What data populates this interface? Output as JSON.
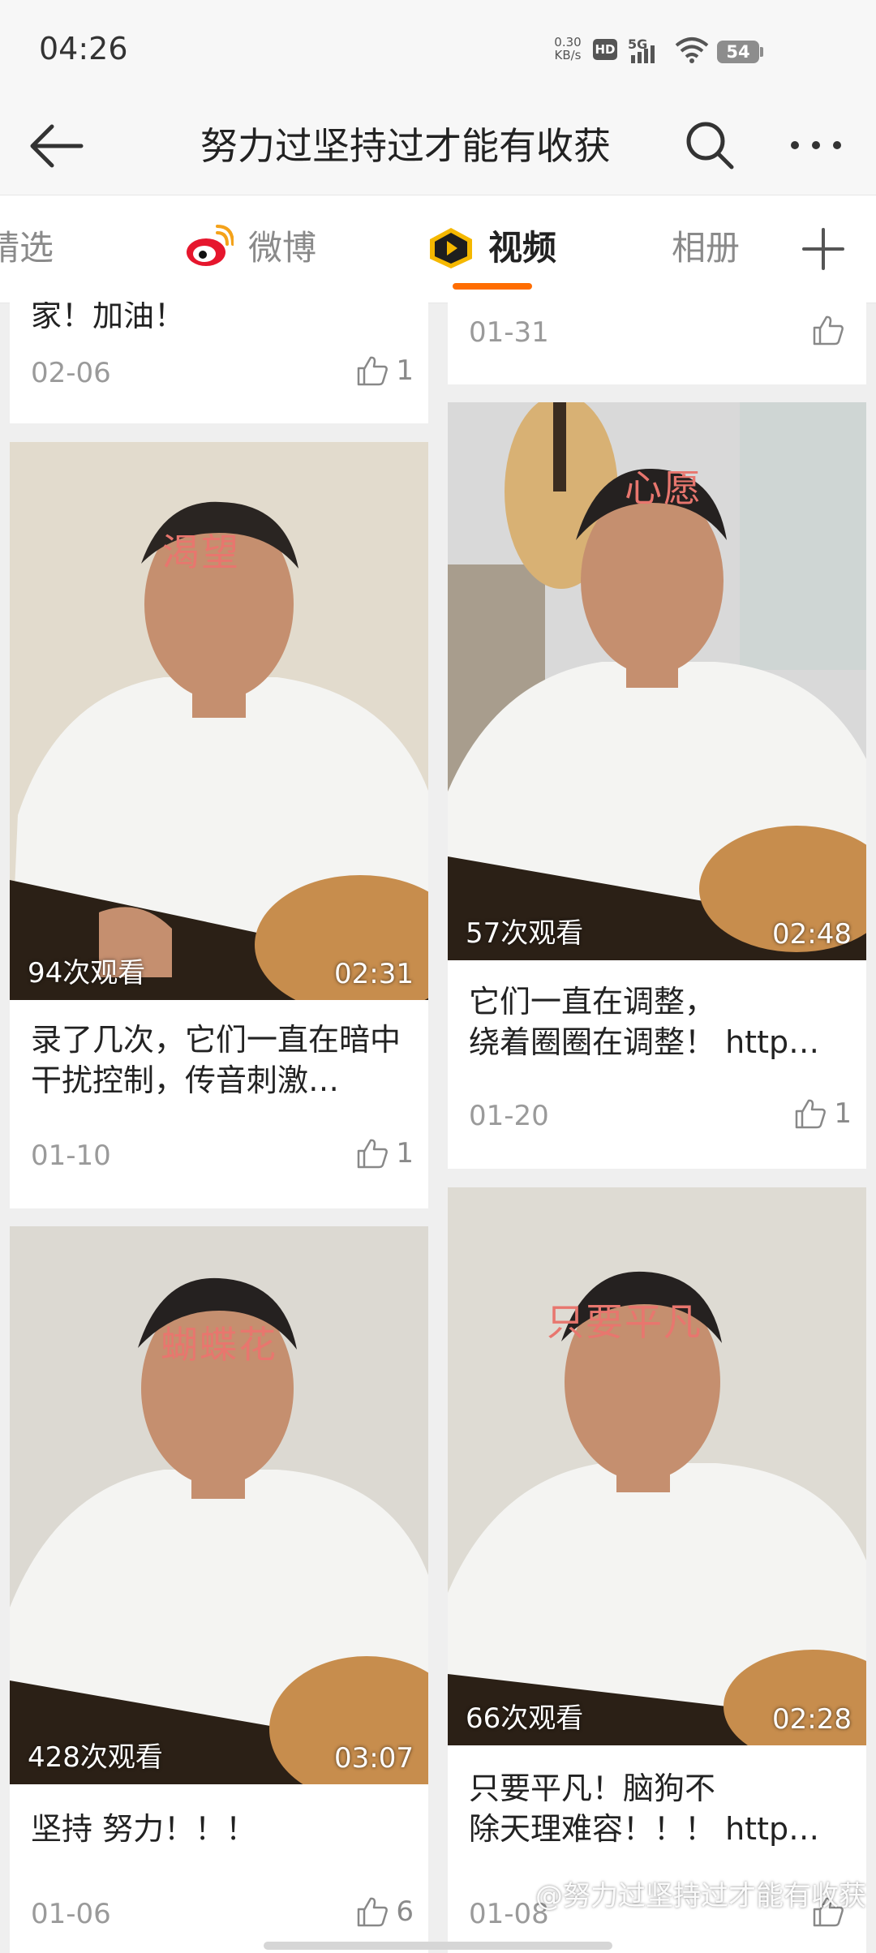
{
  "status": {
    "time": "04:26",
    "net_speed_top": "0.30",
    "net_speed_unit": "KB/s",
    "hd": "HD",
    "network": "5G",
    "battery": "54"
  },
  "nav": {
    "title": "努力过坚持过才能有收获",
    "back_icon": "arrow-left-icon",
    "search_icon": "search-icon",
    "more_icon": "more-icon"
  },
  "tabs": {
    "items": [
      {
        "label": "精选",
        "active": false
      },
      {
        "label": "微博",
        "active": false,
        "icon": "weibo-icon"
      },
      {
        "label": "视频",
        "active": true,
        "icon": "video-icon"
      },
      {
        "label": "相册",
        "active": false
      }
    ],
    "add_icon": "plus-icon",
    "accent": "#ff6d00"
  },
  "posts": [
    {
      "desc": "家！加油！",
      "date": "02-06",
      "likes": "1"
    },
    {
      "desc": "",
      "date": "01-31",
      "likes": ""
    },
    {
      "overlay": "渴望",
      "views": "94次观看",
      "duration": "02:31",
      "desc": "录了几次，它们一直在暗中干扰控制，传音刺激…",
      "date": "01-10",
      "likes": "1"
    },
    {
      "overlay": "心愿",
      "views": "57次观看",
      "duration": "02:48",
      "desc": "它们一直在调整，\n绕着圈圈在调整！ http…",
      "date": "01-20",
      "likes": "1"
    },
    {
      "overlay": "蝴蝶花",
      "views": "428次观看",
      "duration": "03:07",
      "desc": "坚持 努力！！！",
      "date": "01-06",
      "likes": "6"
    },
    {
      "overlay": "只要平凡",
      "views": "66次观看",
      "duration": "02:28",
      "desc": "只要平凡！脑狗不\n除天理难容！！！ http…",
      "date": "01-08",
      "likes": ""
    }
  ],
  "watermark": "@努力过坚持过才能有收获",
  "colors": {
    "overlay_text": "#e8766e",
    "background": "#efefef"
  }
}
